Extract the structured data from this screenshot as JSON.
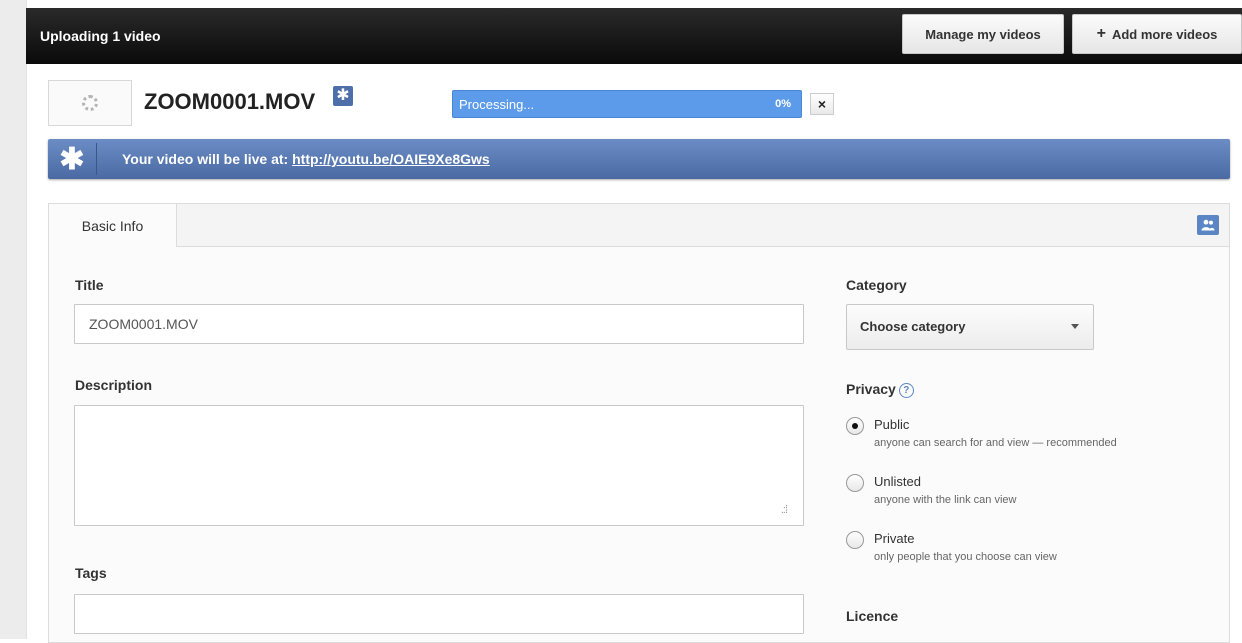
{
  "header": {
    "title": "Uploading 1 video",
    "manage_button": "Manage my videos",
    "add_more_button": "Add more videos",
    "add_more_plus": "+"
  },
  "upload": {
    "filename": "ZOOM0001.MOV",
    "status": "Processing...",
    "progress_percent": 0,
    "progress_label": "0%",
    "cancel": "×"
  },
  "banner": {
    "text": "Your video will be live at:",
    "link": "http://youtu.be/OAIE9Xe8Gws"
  },
  "tabs": [
    {
      "label": "Basic Info"
    }
  ],
  "form": {
    "title_label": "Title",
    "title_value": "ZOOM0001.MOV",
    "description_label": "Description",
    "description_value": "",
    "tags_label": "Tags",
    "tags_value": "",
    "category_label": "Category",
    "category_value": "Choose category",
    "privacy_label": "Privacy",
    "privacy_help": "?",
    "licence_label": "Licence"
  },
  "privacy_options": [
    {
      "label": "Public",
      "desc": "anyone can search for and view — recommended",
      "checked": true
    },
    {
      "label": "Unlisted",
      "desc": "anyone with the link can view",
      "checked": false
    },
    {
      "label": "Private",
      "desc": "only people that you choose can view",
      "checked": false
    }
  ],
  "colors": {
    "accent": "#5b9be9",
    "banner": "#4b6aa3",
    "topbar": "#111111"
  },
  "icons": {
    "spinner": "loading-spinner-icon",
    "star": "star-icon",
    "share": "share-icon",
    "help": "help-icon",
    "close": "close-icon"
  }
}
